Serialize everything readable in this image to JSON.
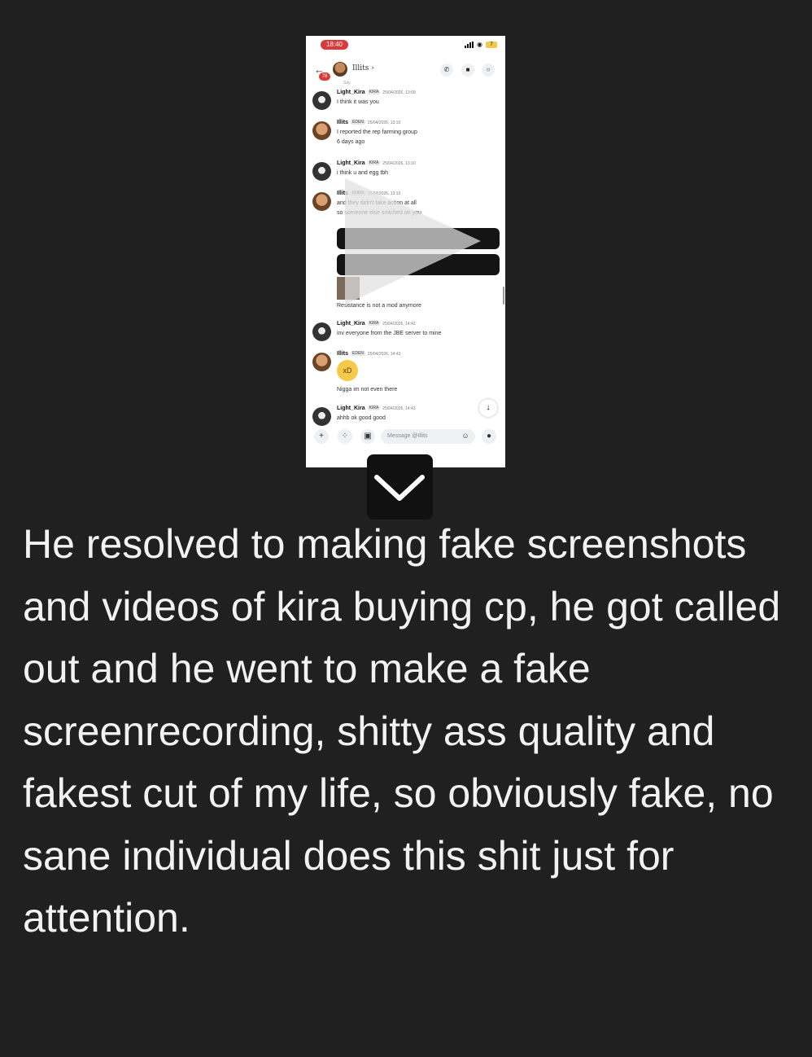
{
  "video": {
    "status_time": "18:40",
    "battery": "7",
    "header": {
      "name": "Illits",
      "badge": "78"
    },
    "top_partial": "Say",
    "messages": [
      {
        "user": "Light_Kira",
        "tag": "KIRA",
        "timestamp": "25/04/2026, 13:09",
        "lines": [
          "I think it was you"
        ]
      },
      {
        "user": "Illits",
        "tag": "EDEN",
        "timestamp": "25/04/2026, 13:10",
        "lines": [
          "I reported the rep farming group",
          "6 days ago"
        ]
      },
      {
        "user": "Light_Kira",
        "tag": "KIRA",
        "timestamp": "25/04/2026, 13:10",
        "lines": [
          "i think u and egg tbh"
        ]
      },
      {
        "user": "Illits",
        "tag": "EDEN",
        "timestamp": "25/04/2026, 13:10",
        "lines": [
          "and they didn't take action at all",
          "so someone else snitched on you"
        ]
      },
      {
        "user": "Light_Kira",
        "tag": "KIRA",
        "timestamp": "25/04/2026, 14:42",
        "lines": [
          "inv everyone from the JBE server to mine"
        ]
      },
      {
        "user": "Illits",
        "tag": "EDEN",
        "timestamp": "25/04/2026, 14:43",
        "lines": []
      },
      {
        "user": "Light_Kira",
        "tag": "KIRA",
        "timestamp": "25/04/2026, 14:43",
        "lines": [
          "ahhb ok good good"
        ]
      }
    ],
    "resistance_line": "Resistance is not a mod anymore",
    "emoji_reply": "Nigga im not even there",
    "composer_placeholder": "Message @Illits"
  },
  "caption": "He resolved to making fake screenshots and videos of kira buying cp, he got called out and he went to make a fake screenrecording, shitty ass quality and fakest cut of my life, so obviously fake, no sane individual does this shit just for attention.",
  "colors": {
    "background": "#202020",
    "caption_text": "#f2f2f2",
    "status_pill": "#d93a3a"
  },
  "icons": [
    "play-icon",
    "chevron-down-icon",
    "back-arrow-icon",
    "phone-icon",
    "video-icon",
    "search-icon",
    "plus-icon",
    "apps-icon",
    "gift-icon",
    "emoji-icon",
    "mic-icon",
    "arrow-down-icon"
  ]
}
